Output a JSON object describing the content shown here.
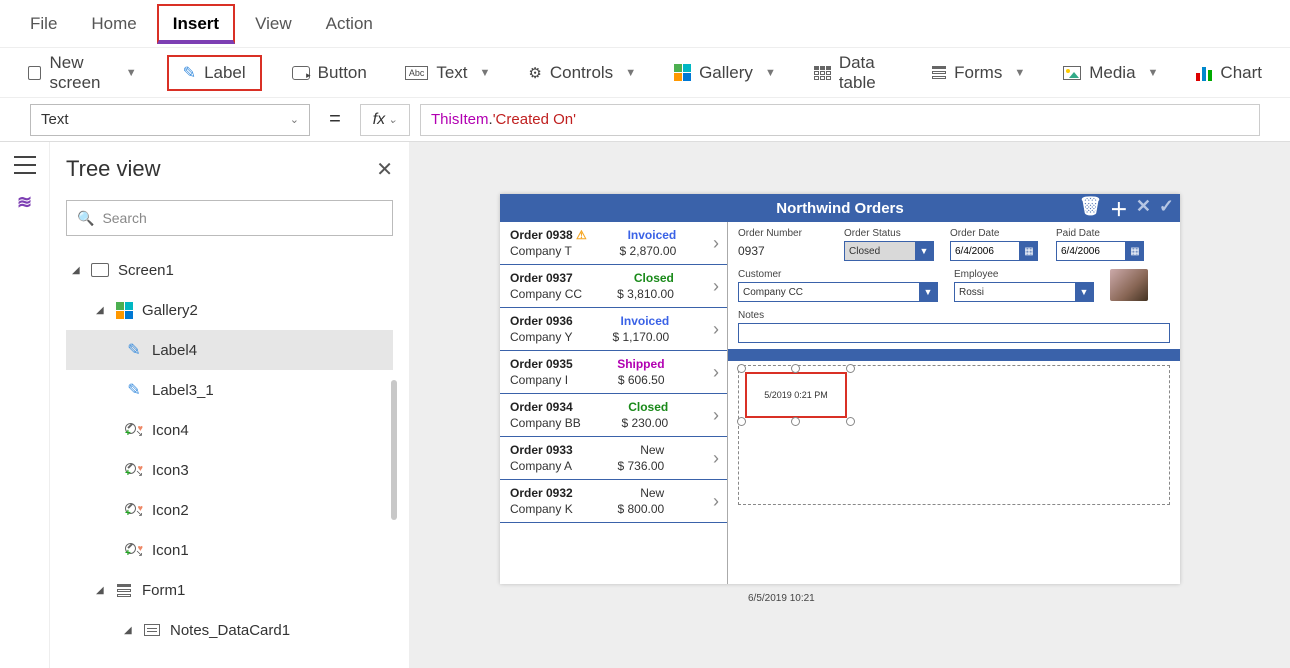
{
  "menu": {
    "tabs": [
      "File",
      "Home",
      "Insert",
      "View",
      "Action"
    ],
    "active": "Insert"
  },
  "ribbon": {
    "new_screen": "New screen",
    "label": "Label",
    "button": "Button",
    "text": "Text",
    "controls": "Controls",
    "gallery": "Gallery",
    "data_table": "Data table",
    "forms": "Forms",
    "media": "Media",
    "chart": "Chart"
  },
  "formula": {
    "property": "Text",
    "fx": "fx",
    "expr_this": "ThisItem",
    "expr_dot": ".",
    "expr_prop": "'Created On'"
  },
  "panel": {
    "title": "Tree view",
    "search_placeholder": "Search",
    "items": [
      {
        "label": "Screen1"
      },
      {
        "label": "Gallery2"
      },
      {
        "label": "Label4"
      },
      {
        "label": "Label3_1"
      },
      {
        "label": "Icon4"
      },
      {
        "label": "Icon3"
      },
      {
        "label": "Icon2"
      },
      {
        "label": "Icon1"
      },
      {
        "label": "Form1"
      },
      {
        "label": "Notes_DataCard1"
      }
    ]
  },
  "preview": {
    "title": "Northwind Orders",
    "orders": [
      {
        "id": "Order 0938",
        "company": "Company T",
        "status": "Invoiced",
        "amount": "$ 2,870.00",
        "warn": true
      },
      {
        "id": "Order 0937",
        "company": "Company CC",
        "status": "Closed",
        "amount": "$ 3,810.00"
      },
      {
        "id": "Order 0936",
        "company": "Company Y",
        "status": "Invoiced",
        "amount": "$ 1,170.00"
      },
      {
        "id": "Order 0935",
        "company": "Company I",
        "status": "Shipped",
        "amount": "$ 606.50"
      },
      {
        "id": "Order 0934",
        "company": "Company BB",
        "status": "Closed",
        "amount": "$ 230.00"
      },
      {
        "id": "Order 0933",
        "company": "Company A",
        "status": "New",
        "amount": "$ 736.00"
      },
      {
        "id": "Order 0932",
        "company": "Company K",
        "status": "New",
        "amount": "$ 800.00"
      }
    ],
    "detail": {
      "labels": {
        "order_number": "Order Number",
        "order_status": "Order Status",
        "order_date": "Order Date",
        "paid_date": "Paid Date",
        "customer": "Customer",
        "employee": "Employee",
        "notes": "Notes"
      },
      "values": {
        "order_number": "0937",
        "order_status": "Closed",
        "order_date": "6/4/2006",
        "paid_date": "6/4/2006",
        "customer": "Company CC",
        "employee": "Rossi",
        "notes": ""
      },
      "selected_label_text": "5/2019 0:21 PM",
      "footer_timestamp": "6/5/2019 10:21"
    }
  }
}
